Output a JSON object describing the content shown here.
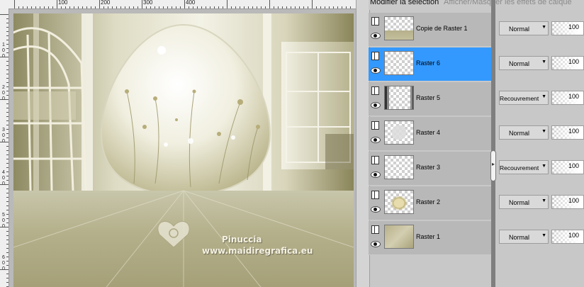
{
  "panel": {
    "tab_selection": "Modifier la sélection",
    "tab_effects": "Afficher/Masquer les effets de calque"
  },
  "ruler": {
    "top_labels": [
      "100",
      "200",
      "300",
      "400"
    ],
    "left_labels": [
      "100",
      "200",
      "300",
      "400",
      "500",
      "600"
    ]
  },
  "watermark": {
    "name": "Pinuccia",
    "url": "www.maidiregrafica.eu"
  },
  "layers": [
    {
      "name": "Copie de Raster 1",
      "blend": "Normal",
      "opacity": "100",
      "selected": false,
      "thumb": "ground"
    },
    {
      "name": "Raster 6",
      "blend": "Normal",
      "opacity": "100",
      "selected": true,
      "thumb": "empty"
    },
    {
      "name": "Raster 5",
      "blend": "Recouvrement",
      "opacity": "100",
      "selected": false,
      "thumb": "frame"
    },
    {
      "name": "Raster 4",
      "blend": "Normal",
      "opacity": "100",
      "selected": false,
      "thumb": "faint"
    },
    {
      "name": "Raster 3",
      "blend": "Recouvrement",
      "opacity": "100",
      "selected": false,
      "thumb": "empty"
    },
    {
      "name": "Raster 2",
      "blend": "Normal",
      "opacity": "100",
      "selected": false,
      "thumb": "flower"
    },
    {
      "name": "Raster 1",
      "blend": "Normal",
      "opacity": "100",
      "selected": false,
      "thumb": "texture"
    }
  ],
  "colors": {
    "selected_row": "#3399ff",
    "scene_tint": "#c9c5a0"
  }
}
